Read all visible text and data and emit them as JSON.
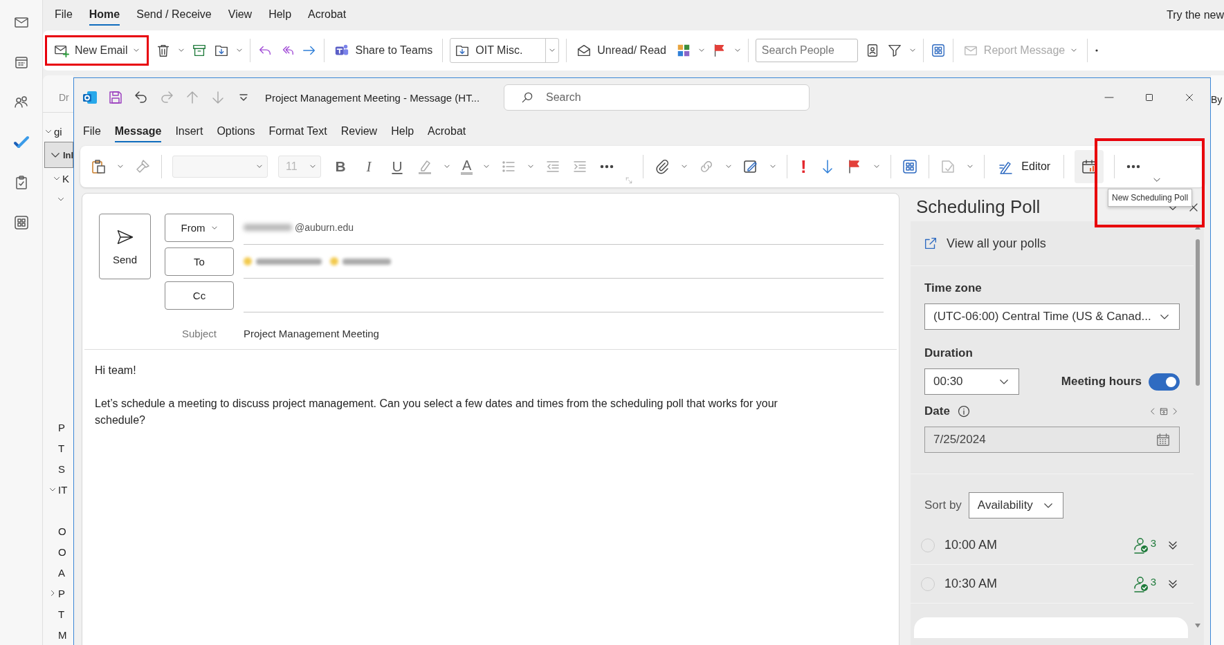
{
  "main_tabs": [
    {
      "label": "File",
      "selected": false
    },
    {
      "label": "Home",
      "selected": true
    },
    {
      "label": "Send / Receive",
      "selected": false
    },
    {
      "label": "View",
      "selected": false
    },
    {
      "label": "Help",
      "selected": false
    },
    {
      "label": "Acrobat",
      "selected": false
    }
  ],
  "top_right_text": "Try the new",
  "main_ribbon": {
    "new_email": {
      "label": "New Email",
      "highlighted": true
    },
    "share_to_teams": "Share to Teams",
    "move_folder": "OIT Misc.",
    "unread_read": "Unread/ Read",
    "search_people": {
      "placeholder": "Search People"
    },
    "report_message": {
      "label": "Report Message",
      "disabled": true
    }
  },
  "folder_pane": {
    "header": "Dr",
    "folders": [
      {
        "label": "gi",
        "expanded": true,
        "selected": false,
        "children": [
          {
            "label": "Inl",
            "expanded": true,
            "selected": true,
            "children": [
              {
                "label": "K",
                "expanded": true,
                "selected": false,
                "children": [
                  {
                    "expanded": true,
                    "selected": false
                  }
                ]
              }
            ]
          }
        ]
      }
    ],
    "more_folders": [
      {
        "label": "P",
        "selected": false
      },
      {
        "label": "T",
        "selected": false
      },
      {
        "label": "S",
        "selected": false
      },
      {
        "label": "IT",
        "expanded": true,
        "selected": false,
        "children": [
          {
            "label": "O",
            "selected": false
          },
          {
            "label": "O",
            "selected": false
          },
          {
            "label": "A",
            "selected": false
          },
          {
            "label": "P",
            "expanded": false,
            "selected": false
          },
          {
            "label": "T",
            "selected": false
          },
          {
            "label": "M",
            "selected": false
          }
        ]
      }
    ]
  },
  "right_edge_text": "By",
  "message_window": {
    "title": "Project Management Meeting  -  Message (HT...",
    "search": {
      "placeholder": "Search"
    },
    "tabs": [
      {
        "label": "File",
        "selected": false
      },
      {
        "label": "Message",
        "selected": true
      },
      {
        "label": "Insert",
        "selected": false
      },
      {
        "label": "Options",
        "selected": false
      },
      {
        "label": "Format Text",
        "selected": false
      },
      {
        "label": "Review",
        "selected": false
      },
      {
        "label": "Help",
        "selected": false
      },
      {
        "label": "Acrobat",
        "selected": false
      }
    ],
    "ribbon": {
      "font_name": {
        "disabled": true
      },
      "font_size": {
        "value": "11",
        "disabled": true
      },
      "format": [
        {
          "kind": "bold",
          "label": "B"
        },
        {
          "kind": "italic",
          "label": "I"
        },
        {
          "kind": "underline",
          "label": "U"
        }
      ],
      "font_color": "A",
      "importance": "!",
      "editor": "Editor",
      "scheduling_poll": {
        "highlighted": true,
        "tooltip": "New Scheduling Poll"
      }
    },
    "compose": {
      "send": "Send",
      "from": {
        "label": "From",
        "address": "@auburn.edu"
      },
      "to": {
        "label": "To"
      },
      "cc": {
        "label": "Cc"
      },
      "subject": {
        "label": "Subject",
        "value": "Project Management Meeting"
      },
      "body": [
        "Hi team!",
        "Let’s schedule a meeting to discuss project management. Can you select a few dates and times from the scheduling poll that works for your schedule?"
      ]
    },
    "scheduling_poll": {
      "title": "Scheduling Poll",
      "view_polls": "View all your polls",
      "time_zone": {
        "label": "Time zone",
        "value": "(UTC-06:00) Central Time (US & Canad..."
      },
      "duration": {
        "label": "Duration",
        "value": "00:30"
      },
      "meeting_hours": {
        "label": "Meeting hours",
        "on": true
      },
      "date": {
        "label": "Date",
        "value": "7/25/2024"
      },
      "sort": {
        "label": "Sort by",
        "value": "Availability"
      },
      "slots": [
        {
          "time": "10:00 AM",
          "count": "3",
          "selected": false
        },
        {
          "time": "10:30 AM",
          "count": "3",
          "selected": false
        }
      ]
    }
  }
}
